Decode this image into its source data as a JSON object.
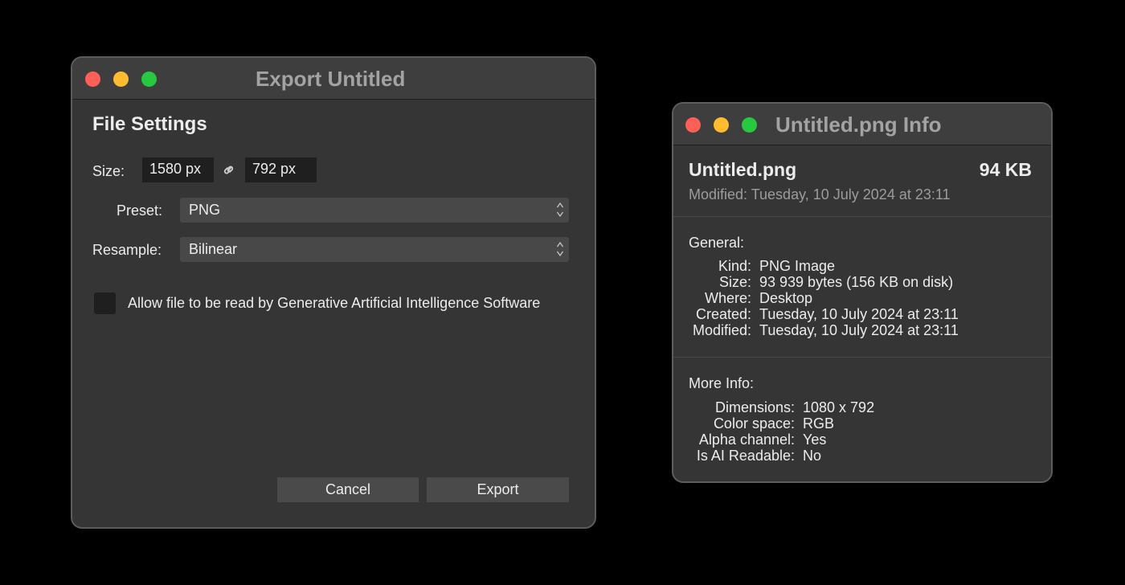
{
  "export_dialog": {
    "title": "Export Untitled",
    "section_heading": "File Settings",
    "size_label": "Size:",
    "width_value": "1580 px",
    "height_value": "792 px",
    "link_icon": "link-icon",
    "preset_label": "Preset:",
    "preset_value": "PNG",
    "resample_label": "Resample:",
    "resample_value": "Bilinear",
    "checkbox_label": "Allow file to be read by Generative Artificial Intelligence Software",
    "checkbox_checked": false,
    "cancel_label": "Cancel",
    "export_label": "Export"
  },
  "info_window": {
    "title": "Untitled.png Info",
    "file_name": "Untitled.png",
    "file_size": "94 KB",
    "modified_line": "Modified: Tuesday, 10 July 2024 at 23:11",
    "general": {
      "heading": "General:",
      "rows": [
        {
          "label": "Kind:",
          "value": "PNG Image"
        },
        {
          "label": "Size:",
          "value": "93 939 bytes (156 KB on disk)"
        },
        {
          "label": "Where:",
          "value": "Desktop"
        },
        {
          "label": "Created:",
          "value": "Tuesday, 10 July 2024 at 23:11"
        },
        {
          "label": "Modified:",
          "value": "Tuesday, 10 July 2024 at 23:11"
        }
      ]
    },
    "more_info": {
      "heading": "More Info:",
      "rows": [
        {
          "label": "Dimensions:",
          "value": "1080 x 792"
        },
        {
          "label": "Color space:",
          "value": "RGB"
        },
        {
          "label": "Alpha channel:",
          "value": "Yes"
        },
        {
          "label": "Is AI Readable:",
          "value": "No"
        }
      ]
    }
  },
  "colors": {
    "close": "#fe5f57",
    "minimize": "#febc2e",
    "zoom": "#28c840",
    "window_bg": "#353535",
    "titlebar_bg": "#3e3e3e"
  }
}
